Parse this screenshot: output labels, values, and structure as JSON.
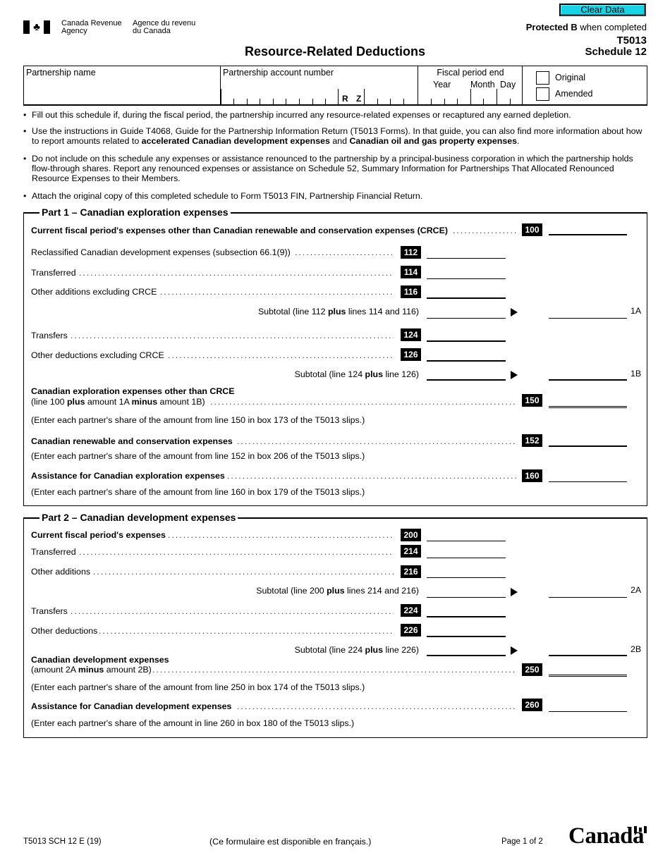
{
  "header": {
    "clear_button": "Clear Data",
    "agency_en_1": "Canada Revenue",
    "agency_en_2": "Agency",
    "agency_fr_1": "Agence du revenu",
    "agency_fr_2": "du Canada",
    "title": "Resource-Related Deductions",
    "protected_bold": "Protected B",
    "protected_rest": " when completed",
    "form_no": "T5013",
    "schedule": "Schedule 12"
  },
  "identification": {
    "partnership_name_label": "Partnership name",
    "partnership_name_value": "",
    "account_label": "Partnership account number",
    "account_value": "",
    "account_rz": "R Z",
    "fiscal_label": "Fiscal period end",
    "year_label": "Year",
    "month_label": "Month",
    "day_label": "Day",
    "original_label": "Original",
    "amended_label": "Amended",
    "original_checked": false,
    "amended_checked": false
  },
  "instructions": [
    {
      "parts": [
        {
          "t": "Fill out this schedule if, during the fiscal period, the partnership incurred any resource-related expenses or recaptured any earned depletion.",
          "b": false
        }
      ]
    },
    {
      "parts": [
        {
          "t": "Use the instructions in Guide T4068, Guide for the Partnership Information Return (T5013 Forms). In that guide, you can also find more information about how to report amounts related to ",
          "b": false
        },
        {
          "t": "accelerated Canadian development expenses",
          "b": true
        },
        {
          "t": " and ",
          "b": false
        },
        {
          "t": "Canadian oil and gas property expenses",
          "b": true
        },
        {
          "t": ".",
          "b": false
        }
      ]
    },
    {
      "parts": [
        {
          "t": "Do not include on this schedule any expenses or assistance renounced to the partnership by a principal-business corporation in which the partnership holds flow-through shares. Report any renounced expenses or assistance on Schedule 52, Summary Information for Partnerships That Allocated Renounced Resource Expenses to their Members.",
          "b": false
        }
      ]
    },
    {
      "parts": [
        {
          "t": "Attach the original copy of this completed schedule to Form T5013 FIN, Partnership Financial Return.",
          "b": false
        }
      ]
    }
  ],
  "part1": {
    "title": "Part 1 – Canadian exploration expenses",
    "line100": {
      "label": "Current fiscal period's expenses other than Canadian renewable and conservation expenses (CRCE)",
      "code": "100",
      "value": ""
    },
    "line112": {
      "label": "Reclassified Canadian development expenses (subsection 66.1(9))",
      "code": "112",
      "value": ""
    },
    "line114": {
      "label": "Transferred",
      "code": "114",
      "value": ""
    },
    "line116": {
      "label": "Other additions excluding CRCE",
      "code": "116",
      "value": ""
    },
    "subtotal1a": {
      "pre": "Subtotal (line 112 ",
      "bold": "plus",
      "post": " lines 114 and 116)",
      "ref": "1A",
      "value_left": "",
      "value_right": ""
    },
    "line124": {
      "label": "Transfers",
      "code": "124",
      "value": ""
    },
    "line126": {
      "label": "Other deductions excluding CRCE",
      "code": "126",
      "value": ""
    },
    "subtotal1b": {
      "pre": "Subtotal (line 124 ",
      "bold": "plus",
      "post": " line 126)",
      "ref": "1B",
      "value_left": "",
      "value_right": ""
    },
    "line150": {
      "label": "Canadian exploration expenses other than CRCE",
      "sub_pre": "(line 100 ",
      "sub_b1": "plus",
      "sub_mid": " amount 1A ",
      "sub_b2": "minus",
      "sub_post": " amount 1B)",
      "code": "150",
      "value": ""
    },
    "note150": "(Enter each partner's share of the amount from line 150 in box 173 of the T5013 slips.)",
    "line152": {
      "label": "Canadian renewable and conservation expenses",
      "code": "152",
      "value": ""
    },
    "note152": "(Enter each partner's share of the amount from line 152 in box 206 of the T5013 slips.)",
    "line160": {
      "label": "Assistance for Canadian exploration expenses",
      "code": "160",
      "value": ""
    },
    "note160": "(Enter each partner's share of the amount from line 160 in box 179 of the T5013 slips.)"
  },
  "part2": {
    "title": "Part 2 – Canadian development expenses",
    "line200": {
      "label": "Current fiscal period's expenses",
      "code": "200",
      "value": ""
    },
    "line214": {
      "label": "Transferred",
      "code": "214",
      "value": ""
    },
    "line216": {
      "label": "Other additions",
      "code": "216",
      "value": ""
    },
    "subtotal2a": {
      "pre": "Subtotal (line 200 ",
      "bold": "plus",
      "post": " lines 214 and 216)",
      "ref": "2A",
      "value_left": "",
      "value_right": ""
    },
    "line224": {
      "label": "Transfers",
      "code": "224",
      "value": ""
    },
    "line226": {
      "label": "Other deductions",
      "code": "226",
      "value": ""
    },
    "subtotal2b": {
      "pre": "Subtotal (line 224 ",
      "bold": "plus",
      "post": " line 226)",
      "ref": "2B",
      "value_left": "",
      "value_right": ""
    },
    "line250": {
      "label": "Canadian development expenses",
      "sub_pre": "(amount 2A ",
      "sub_b1": "minus",
      "sub_post": " amount 2B)",
      "code": "250",
      "value": ""
    },
    "note250": "(Enter each partner's share of the amount from line 250 in box 174 of the T5013 slips.)",
    "line260": {
      "label": "Assistance for Canadian development expenses",
      "code": "260",
      "value": ""
    },
    "note260": "(Enter each partner's share of the amount in line 260 in box 180 of the T5013 slips.)"
  },
  "footer": {
    "form_code": "T5013 SCH 12 E (19)",
    "french_note": "(Ce formulaire est disponible en français.)",
    "page": "Page 1 of 2",
    "wordmark": "Canada"
  }
}
